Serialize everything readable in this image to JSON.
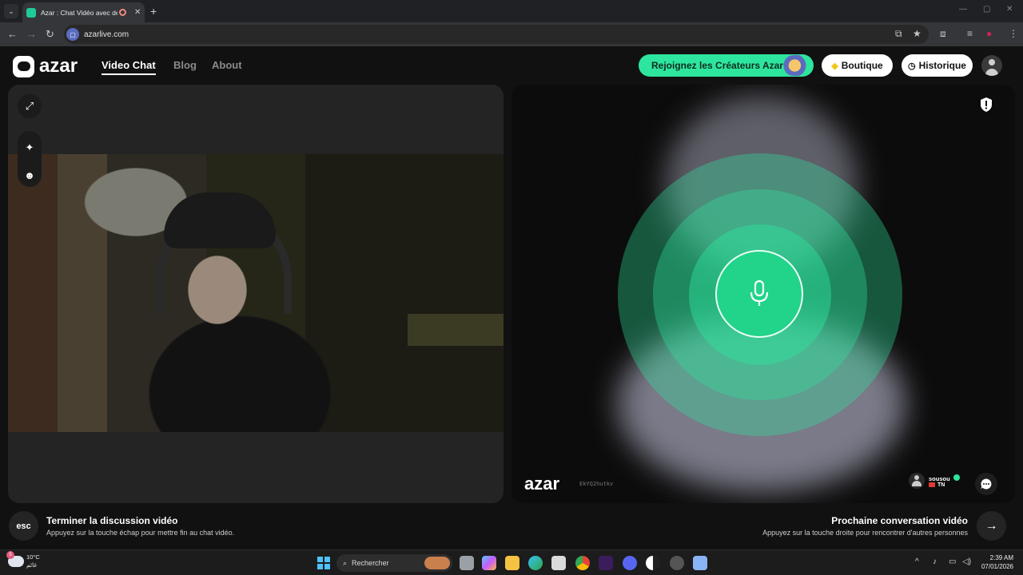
{
  "browser": {
    "tab_title": "Azar : Chat Vidéo avec de n",
    "tab_close": "✕",
    "new_tab": "+",
    "url": "azarlive.com"
  },
  "header": {
    "logo_text": "azar",
    "nav": [
      {
        "label": "Video Chat",
        "active": true
      },
      {
        "label": "Blog",
        "active": false
      },
      {
        "label": "About",
        "active": false
      }
    ],
    "creators_button": "Rejoignez les Créateurs Azar",
    "shop_button": "Boutique",
    "history_button": "Historique"
  },
  "partner": {
    "watermark_logo": "azar",
    "watermark_code": "EkYQ2hutkv",
    "name": "sousou",
    "country": "TN"
  },
  "hints": {
    "esc_key": "esc",
    "end_title": "Terminer la discussion vidéo",
    "end_sub": "Appuyez sur la touche échap pour mettre fin au chat vidéo.",
    "next_title": "Prochaine conversation vidéo",
    "next_sub": "Appuyez sur la touche droite pour rencontrer d'autres personnes",
    "next_key": "→"
  },
  "taskbar": {
    "temperature": "10°C",
    "weather_label": "غائم",
    "weather_badge": "5",
    "search_placeholder": "Rechercher",
    "time": "2:39 AM",
    "date": "07/01/2026"
  },
  "colors": {
    "accent": "#2ee59d",
    "panel": "#242424",
    "page_bg": "#111111"
  }
}
